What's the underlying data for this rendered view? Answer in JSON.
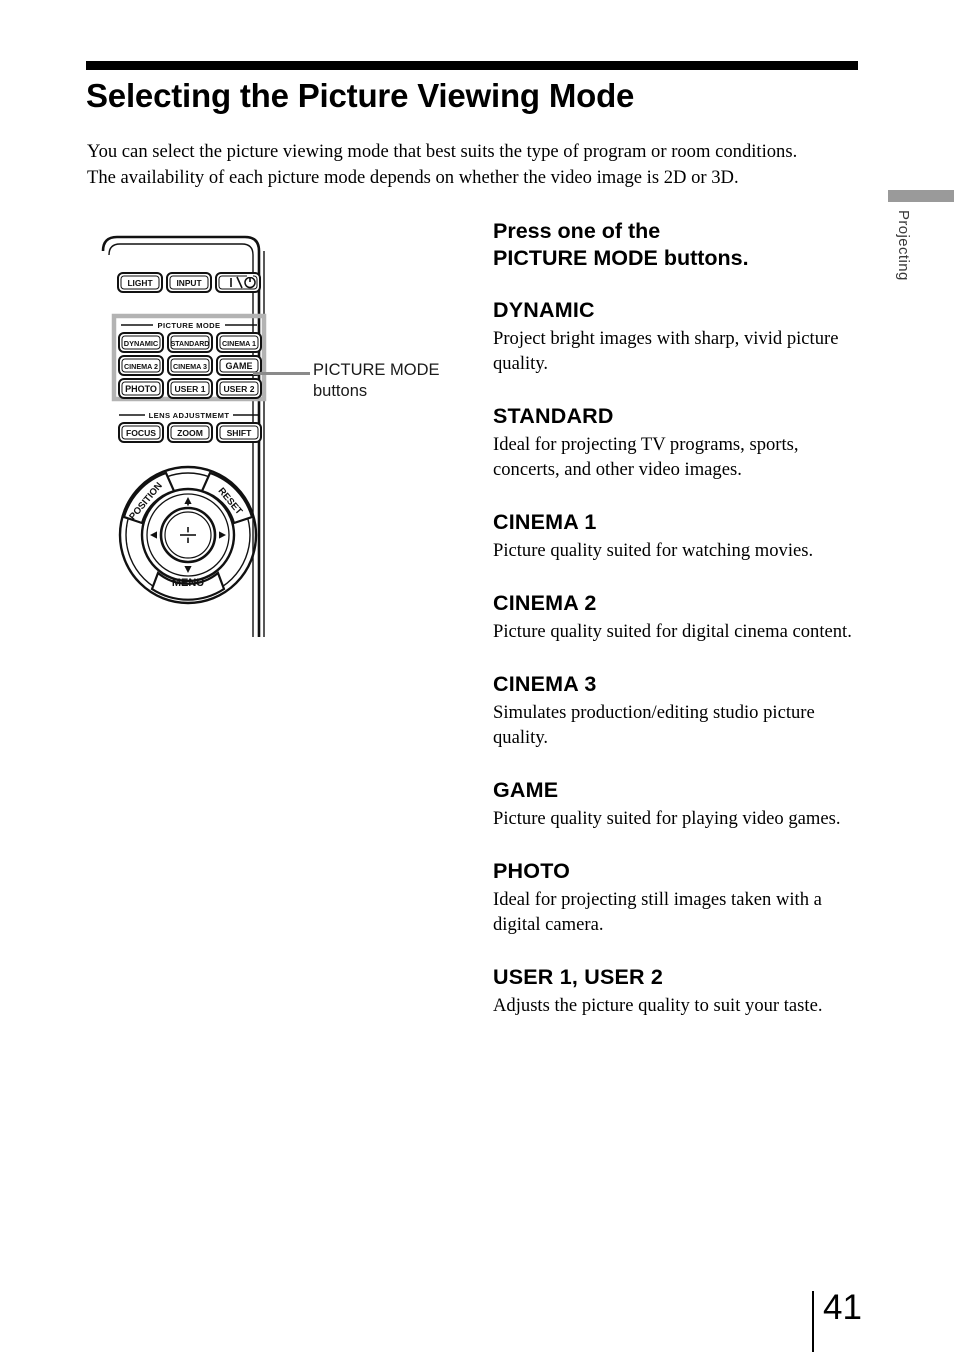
{
  "page": {
    "title": "Selecting the Picture Viewing Mode",
    "number": "41",
    "side_tab": "Projecting",
    "intro_line1": "You can select the picture viewing mode that best suits the type of program or room conditions.",
    "intro_line2": "The availability of each picture mode depends on whether the video image is 2D or 3D."
  },
  "callout": {
    "line1": "PICTURE MODE",
    "line2": "buttons"
  },
  "instruction": {
    "line1": "Press one of the",
    "line2": "PICTURE MODE buttons."
  },
  "modes": [
    {
      "name": "DYNAMIC",
      "description": "Project bright images with sharp, vivid picture quality."
    },
    {
      "name": "STANDARD",
      "description": "Ideal for projecting TV programs, sports, concerts, and other video images."
    },
    {
      "name": "CINEMA 1",
      "description": "Picture quality suited for watching movies."
    },
    {
      "name": "CINEMA 2",
      "description": "Picture quality suited for digital cinema content."
    },
    {
      "name": "CINEMA 3",
      "description": "Simulates production/editing studio picture quality."
    },
    {
      "name": "GAME",
      "description": "Picture quality suited for playing video games."
    },
    {
      "name": "PHOTO",
      "description": "Ideal for projecting still images taken with a digital camera."
    },
    {
      "name": "USER 1, USER 2",
      "description": "Adjusts the picture quality to suit your taste."
    }
  ],
  "remote": {
    "top_row": [
      "LIGHT",
      "INPUT",
      "I / ⏻"
    ],
    "picture_mode_label": "PICTURE MODE",
    "picture_mode_buttons": [
      "DYNAMIC",
      "STANDARD",
      "CINEMA 1",
      "CINEMA 2",
      "CINEMA 3",
      "GAME",
      "PHOTO",
      "USER 1",
      "USER 2"
    ],
    "lens_label": "LENS ADJUSTMEMT",
    "lens_buttons": [
      "FOCUS",
      "ZOOM",
      "SHIFT"
    ],
    "wheel": {
      "position": "POSITION",
      "reset": "RESET",
      "menu": "MENU"
    }
  },
  "colors": {
    "rule": "#000000",
    "side_tab_gray": "#9a9a9a",
    "callout_gray": "#8a8a8a",
    "highlight_gray": "#b3b3b3"
  }
}
